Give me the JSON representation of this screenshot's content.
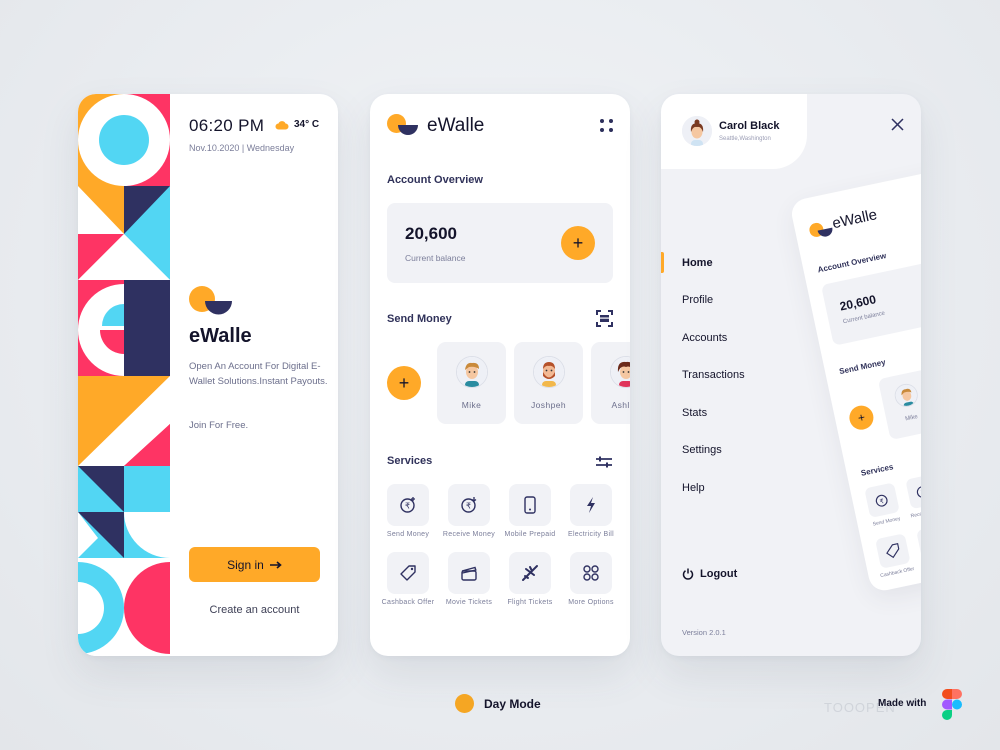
{
  "colors": {
    "accent": "#ffa928",
    "navy": "#2f3161",
    "pink": "#fe3464",
    "cyan": "#52d6f3",
    "card_gray": "#f1f2f6"
  },
  "welcome": {
    "time": "06:20 PM",
    "weather_icon": "cloud-icon",
    "temperature": "34° C",
    "date": "Nov.10.2020 | Wednesday",
    "brand": "eWalle",
    "description": "Open An Account For Digital E-Wallet Solutions.Instant Payouts.",
    "join_text": "Join For Free.",
    "signin_label": "Sign in",
    "signin_icon": "arrow-right-icon",
    "create_account_label": "Create an account"
  },
  "home": {
    "brand": "eWalle",
    "menu_icon": "grid-dots-icon",
    "account_overview_title": "Account Overview",
    "balance_amount": "20,600",
    "balance_label": "Current balance",
    "add_balance_label": "+",
    "send_money_title": "Send Money",
    "scan_icon": "scan-icon",
    "add_contact_label": "+",
    "contacts": [
      {
        "name": "Mike"
      },
      {
        "name": "Joshpeh"
      },
      {
        "name": "Ashley"
      }
    ],
    "services_title": "Services",
    "filter_icon": "sliders-icon",
    "services": [
      {
        "label": "Send Money",
        "icon": "rupee-send-icon"
      },
      {
        "label": "Receive Money",
        "icon": "rupee-receive-icon"
      },
      {
        "label": "Mobile Prepaid",
        "icon": "mobile-icon"
      },
      {
        "label": "Electricity Bill",
        "icon": "lightning-icon"
      },
      {
        "label": "Cashback Offer",
        "icon": "tag-icon"
      },
      {
        "label": "Movie Tickets",
        "icon": "clapperboard-icon"
      },
      {
        "label": "Flight Tickets",
        "icon": "airplane-icon"
      },
      {
        "label": "More Options",
        "icon": "more-circles-icon"
      }
    ]
  },
  "menu": {
    "user_name": "Carol Black",
    "user_location": "Seattle,Washington",
    "close_icon": "close-icon",
    "nav_items": [
      {
        "label": "Home",
        "active": true
      },
      {
        "label": "Profile",
        "active": false
      },
      {
        "label": "Accounts",
        "active": false
      },
      {
        "label": "Transactions",
        "active": false
      },
      {
        "label": "Stats",
        "active": false
      },
      {
        "label": "Settings",
        "active": false
      },
      {
        "label": "Help",
        "active": false
      }
    ],
    "logout_label": "Logout",
    "version": "Version 2.0.1",
    "preview": {
      "brand": "eWalle",
      "account_overview_title": "Account Overview",
      "balance_amount": "20,600",
      "balance_label": "Current balance",
      "send_money_title": "Send Money",
      "contact_name": "Mike",
      "add_label": "+",
      "services_title": "Services",
      "service_labels": [
        "Send Money",
        "Receive Money",
        "Cashback Offer"
      ]
    }
  },
  "footer": {
    "mode_label": "Day Mode",
    "made_with_label": "Made with",
    "watermark": "TOOOPEN"
  }
}
